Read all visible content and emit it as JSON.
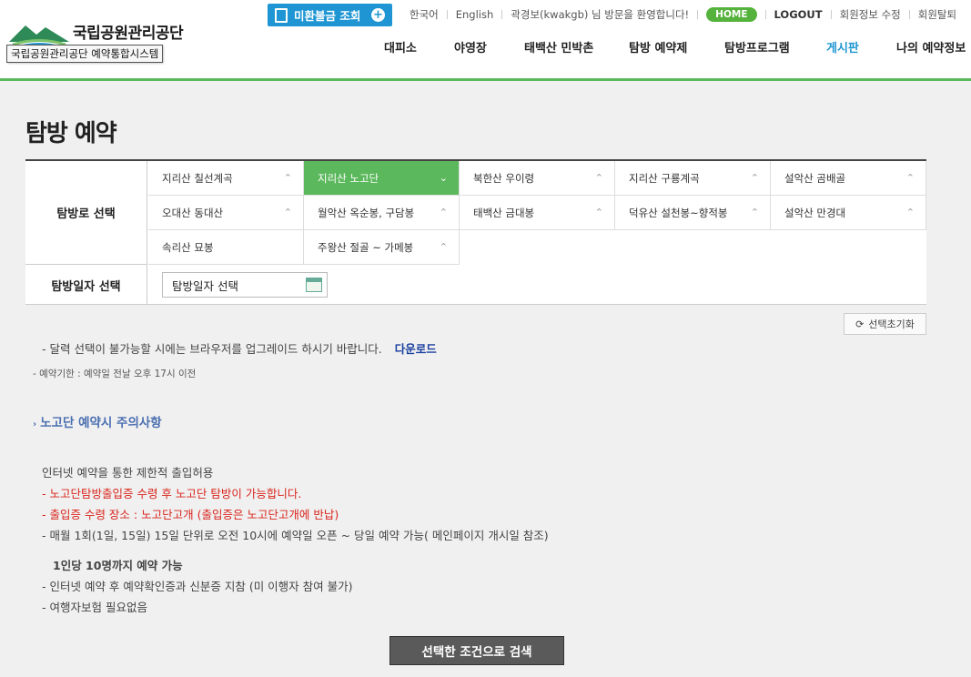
{
  "header": {
    "logo_text": "국립공원관리공단",
    "logo_tooltip": "국립공원관리공단 예약통합시스템",
    "unpaid_button": "미환불금 조회",
    "util": {
      "korean": "한국어",
      "english": "English",
      "welcome": "곽경보(kwakgb) 님 방문을 환영합니다!",
      "home": "HOME",
      "logout": "LOGOUT",
      "edit_member": "회원정보 수정",
      "withdraw": "회원탈퇴"
    },
    "nav": [
      "대피소",
      "야영장",
      "태백산 민박촌",
      "탐방 예약제",
      "탐방프로그램",
      "게시판",
      "나의 예약정보"
    ],
    "nav_active_index": 5,
    "accent_color": "#5cb85c",
    "nav_active_color": "#1f96d3"
  },
  "page": {
    "title": "탐방 예약",
    "trail_label": "탐방로 선택",
    "date_label": "탐방일자 선택",
    "date_select_text": "탐방일자 선택",
    "trails": [
      "지리산 칠선계곡",
      "지리산 노고단",
      "북한산 우이령",
      "지리산 구룡계곡",
      "설악산 곰배골",
      "오대산 동대산",
      "월악산 옥순봉, 구담봉",
      "태백산 금대봉",
      "덕유산 설천봉~향적봉",
      "설악산 만경대",
      "속리산 묘봉",
      "주왕산 절골 ~ 가메봉"
    ],
    "selected_trail_index": 1,
    "reset_button": "선택초기화",
    "browser_note": "- 달력 선택이 불가능할 시에는 브라우저를 업그레이드 하시기 바랍니다.",
    "download_link": "다운로드",
    "deadline_note": "- 예약기한 : 예약일 전날 오후 17시 이전",
    "section_title": "노고단 예약시 주의사항",
    "notices": [
      {
        "text": "인터넷 예약을 통한 제한적 출입허용",
        "style": "normal"
      },
      {
        "text": "- 노고단탐방출입증 수령 후 노고단 탐방이 가능합니다.",
        "style": "red"
      },
      {
        "text": "- 출입증 수령 장소 : 노고단고개 (출입증은 노고단고개에 반납)",
        "style": "red"
      },
      {
        "text": "- 매월 1회(1일, 15일) 15일 단위로 오전 10시에 예약일 오픈 ~ 당일 예약 가능( 메인페이지 개시일 참조)",
        "style": "normal"
      },
      {
        "text": "1인당 10명까지 예약 가능",
        "style": "bold"
      },
      {
        "text": "- 인터넷 예약 후 예약확인증과 신분증 지참 (미 이행자 참여 불가)",
        "style": "normal"
      },
      {
        "text": "- 여행자보험 필요없음",
        "style": "normal"
      }
    ],
    "search_button": "선택한 조건으로 검색"
  }
}
